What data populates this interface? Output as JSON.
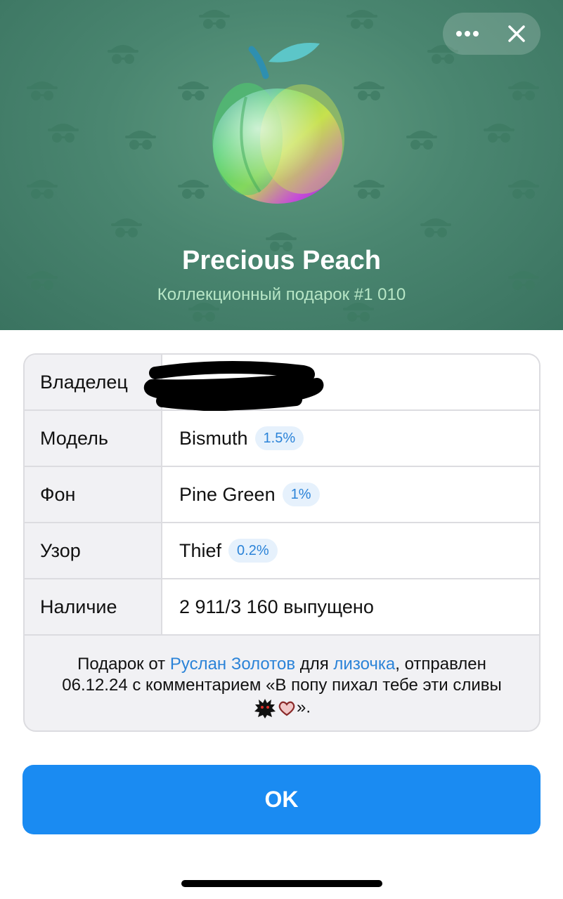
{
  "header": {
    "title": "Precious Peach",
    "subtitle": "Коллекционный подарок #1 010",
    "background_color": "#4a8670",
    "icons": [
      "more-dots-icon",
      "close-icon"
    ]
  },
  "table": {
    "rows": [
      {
        "label": "Владелец",
        "value": "",
        "badge": ""
      },
      {
        "label": "Модель",
        "value": "Bismuth",
        "badge": "1.5%"
      },
      {
        "label": "Фон",
        "value": "Pine Green",
        "badge": "1%"
      },
      {
        "label": "Узор",
        "value": "Thief",
        "badge": "0.2%"
      },
      {
        "label": "Наличие",
        "value": "2 911/3 160 выпущено",
        "badge": ""
      }
    ]
  },
  "caption": {
    "prefix": "Подарок от ",
    "sender": "Руслан Золотов",
    "mid": " для ",
    "recipient": "лизочка",
    "suffix": ", отправлен 06.12.24 с комментарием «В попу пихал тебе эти сливы ",
    "end": "»."
  },
  "ok_button": {
    "label": "OK",
    "color": "#1a8bf2"
  },
  "link_color": "#2b83d8"
}
